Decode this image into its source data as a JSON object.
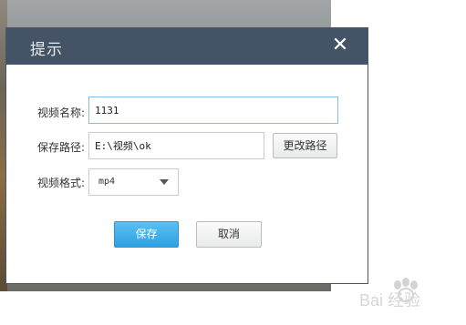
{
  "dialog": {
    "title": "提示",
    "close_label": "✕",
    "name_label": "视频名称:",
    "name_value": "1131",
    "path_label": "保存路径:",
    "path_value": "E:\\视频\\ok",
    "change_path_label": "更改路径",
    "format_label": "视频格式:",
    "format_value": "mp4",
    "save_label": "保存",
    "cancel_label": "取消"
  },
  "colors": {
    "titlebar": "#445365",
    "primary_button": "#2ea0e2",
    "background_window": "#7e7f7d"
  },
  "icons": {
    "close": "close-icon",
    "dropdown": "chevron-down-icon",
    "watermark": "baidu-jingyan-watermark"
  },
  "watermark": {
    "text": "Bai 经验"
  }
}
